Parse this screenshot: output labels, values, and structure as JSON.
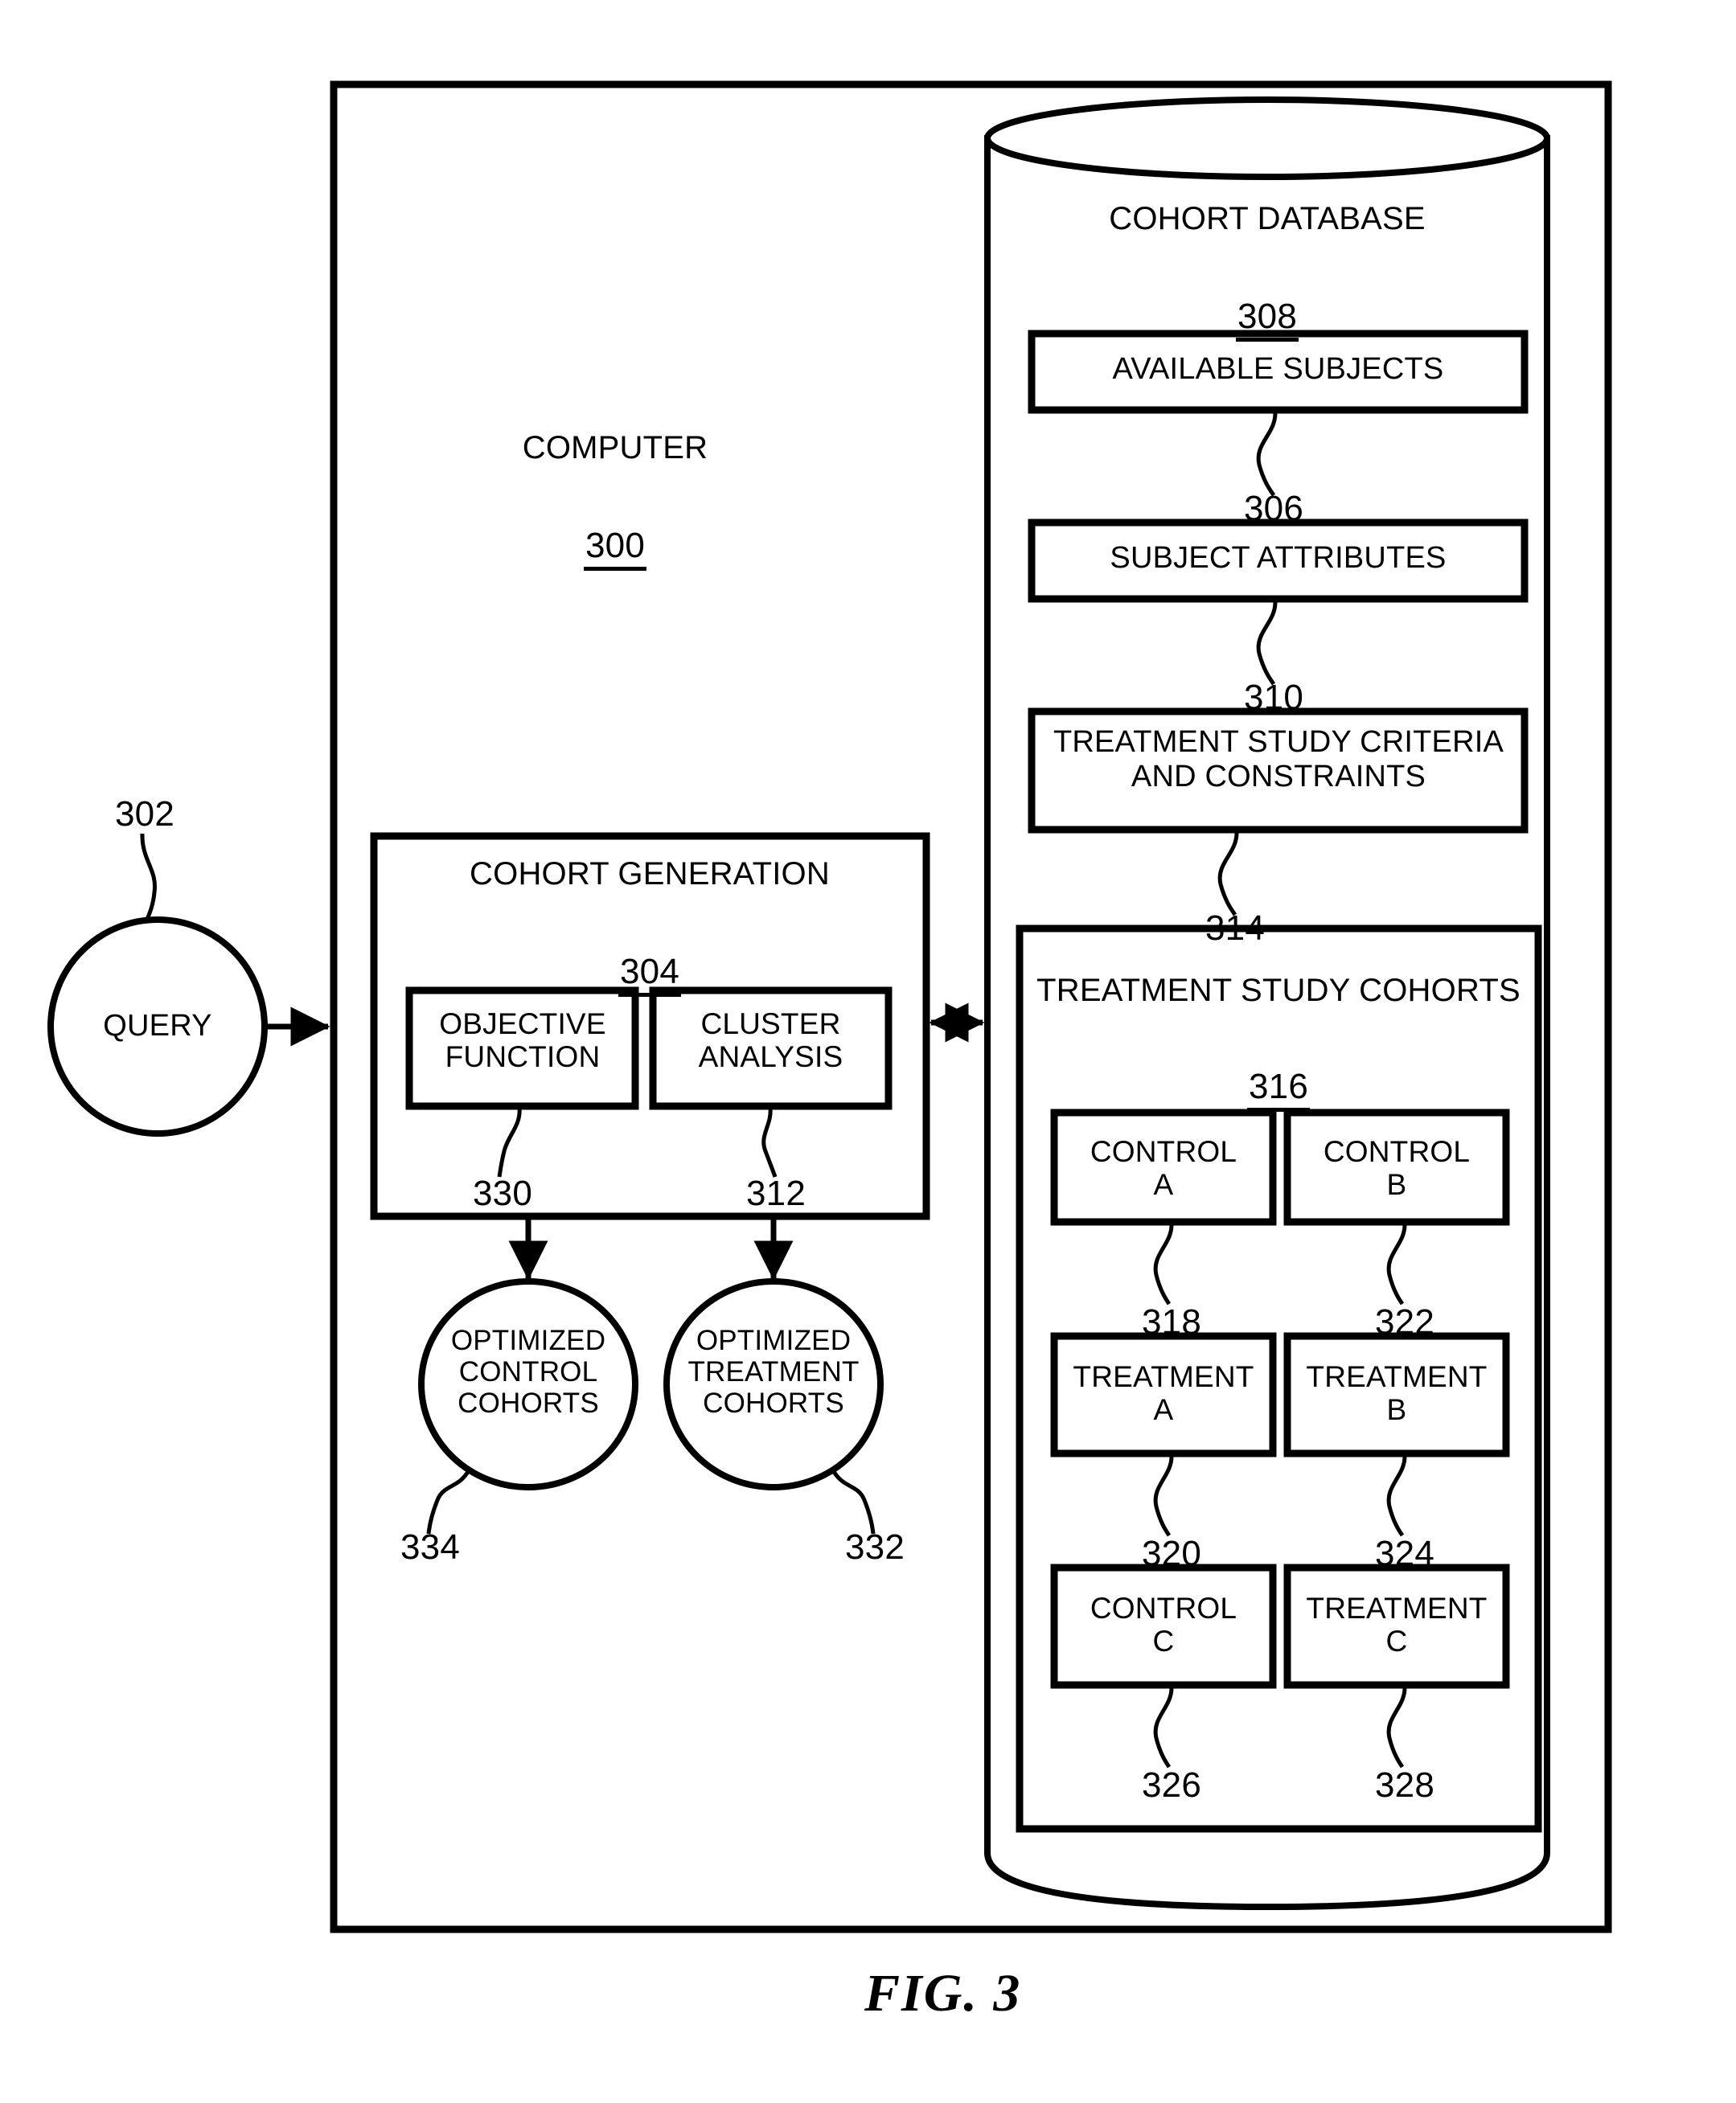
{
  "figure": {
    "caption": "FIG. 3"
  },
  "computer": {
    "title": "COMPUTER",
    "ref": "300"
  },
  "query": {
    "label": "QUERY",
    "ref": "302"
  },
  "cohort_generation": {
    "title": "COHORT GENERATION",
    "ref": "304",
    "modules": [
      {
        "label": "OBJECTIVE\nFUNCTION",
        "ref": "330"
      },
      {
        "label": "CLUSTER\nANALYSIS",
        "ref": "312"
      }
    ],
    "outputs": [
      {
        "label": "OPTIMIZED\nCONTROL\nCOHORTS",
        "ref": "334"
      },
      {
        "label": "OPTIMIZED\nTREATMENT\nCOHORTS",
        "ref": "332"
      }
    ]
  },
  "cohort_database": {
    "title": "COHORT DATABASE",
    "ref": "308",
    "items": [
      {
        "label": "AVAILABLE SUBJECTS",
        "ref": "306"
      },
      {
        "label": "SUBJECT ATTRIBUTES",
        "ref": "310"
      },
      {
        "label": "TREATMENT STUDY CRITERIA\nAND CONSTRAINTS",
        "ref": "314"
      }
    ],
    "cohorts_panel": {
      "title": "TREATMENT STUDY COHORTS",
      "ref": "316",
      "cells": [
        {
          "label": "CONTROL\nA",
          "ref": "318"
        },
        {
          "label": "CONTROL\nB",
          "ref": "322"
        },
        {
          "label": "TREATMENT\nA",
          "ref": "320"
        },
        {
          "label": "TREATMENT\nB",
          "ref": "324"
        },
        {
          "label": "CONTROL\nC",
          "ref": "326"
        },
        {
          "label": "TREATMENT\nC",
          "ref": "328"
        }
      ]
    }
  },
  "colors": {
    "stroke": "#000000",
    "background": "#ffffff"
  }
}
